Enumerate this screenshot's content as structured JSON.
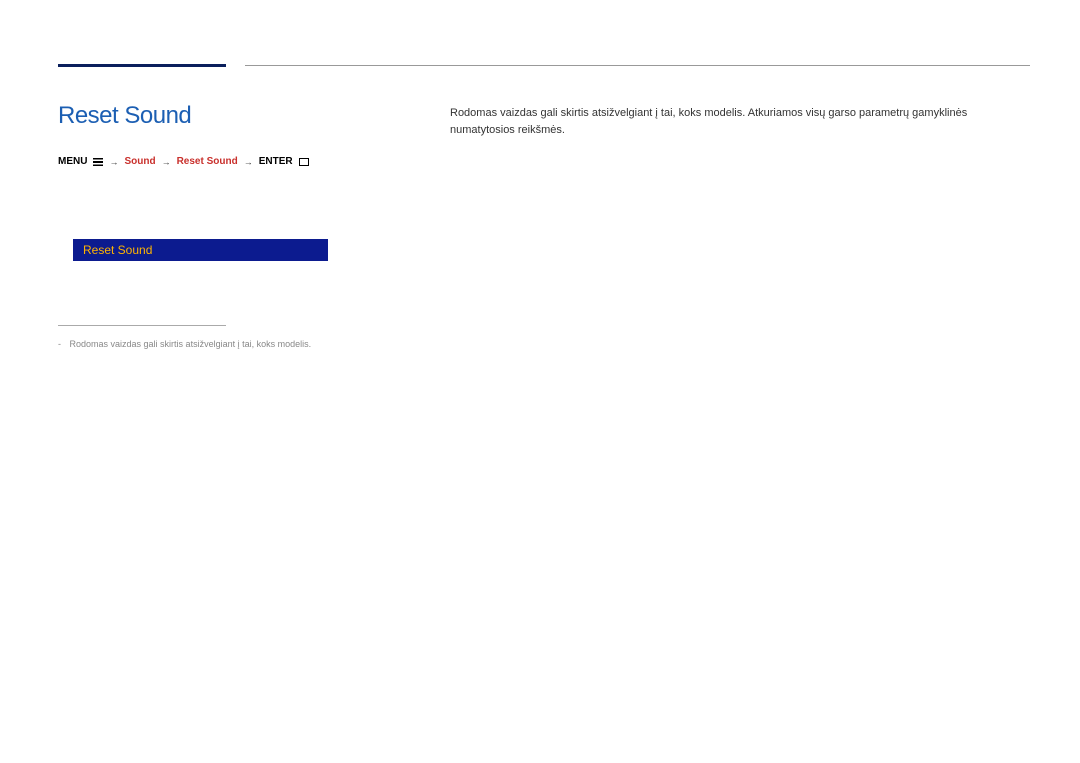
{
  "title": "Reset Sound",
  "breadcrumb": {
    "menu": "MENU",
    "sound": "Sound",
    "reset_sound": "Reset Sound",
    "enter": "ENTER"
  },
  "body_text": "Rodomas vaizdas gali skirtis atsižvelgiant į tai, koks modelis. Atkuriamos visų garso parametrų gamyklinės numatytosios reikšmės.",
  "menu": {
    "selected": "Reset Sound"
  },
  "footnote": {
    "dash": "-",
    "text": "Rodomas vaizdas gali skirtis atsižvelgiant į tai, koks modelis."
  }
}
